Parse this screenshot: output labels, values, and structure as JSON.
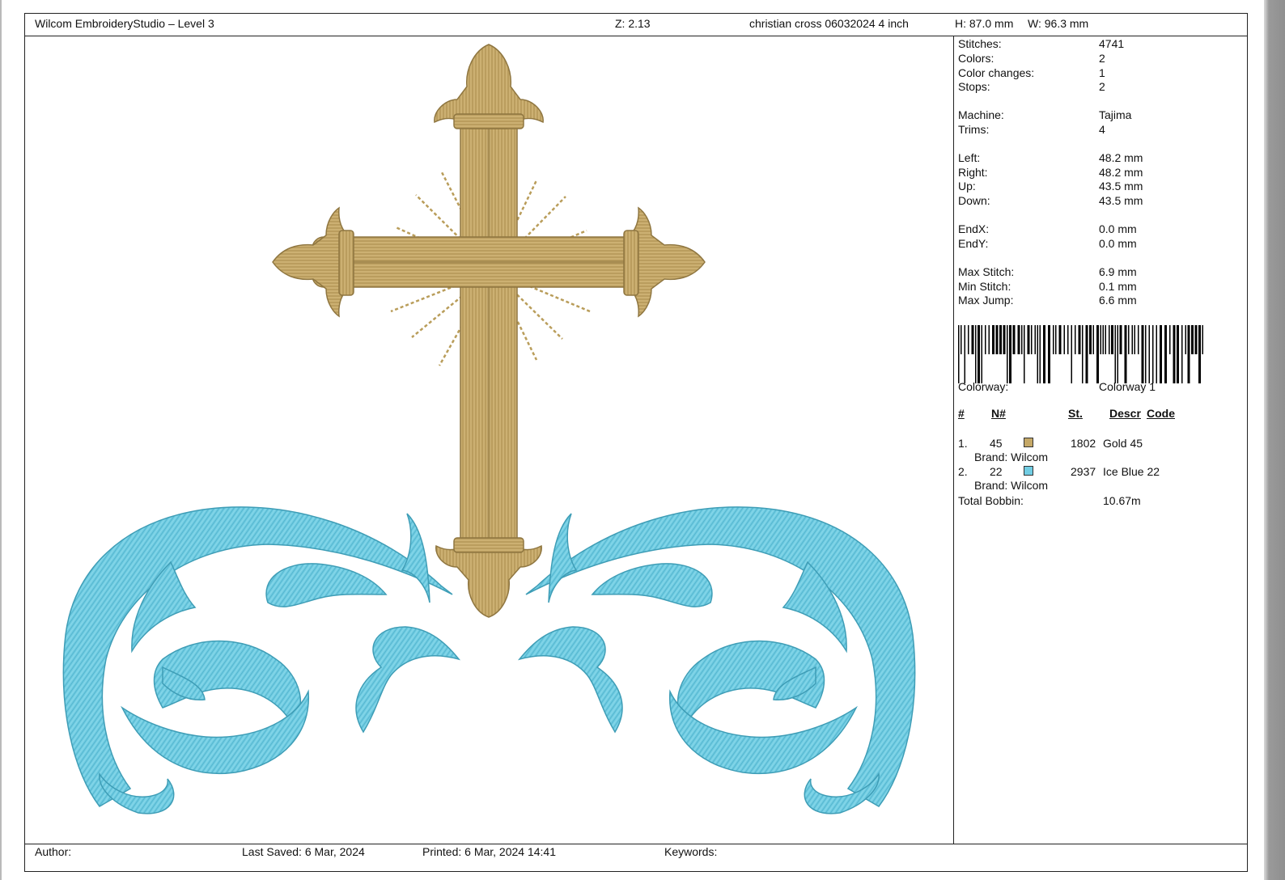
{
  "header": {
    "app_title": "Wilcom EmbroideryStudio – Level 3",
    "zoom": "Z: 2.13",
    "design_name": "christian cross 06032024 4 inch",
    "height": "H: 87.0 mm",
    "width": "W: 96.3 mm"
  },
  "stats": [
    {
      "label": "Stitches:",
      "value": "4741"
    },
    {
      "label": "Colors:",
      "value": "2"
    },
    {
      "label": "Color changes:",
      "value": "1"
    },
    {
      "label": "Stops:",
      "value": "2"
    },
    {
      "label": "Machine:",
      "value": "Tajima"
    },
    {
      "label": "Trims:",
      "value": "4"
    },
    {
      "label": "Left:",
      "value": "48.2 mm"
    },
    {
      "label": "Right:",
      "value": "48.2 mm"
    },
    {
      "label": "Up:",
      "value": "43.5 mm"
    },
    {
      "label": "Down:",
      "value": "43.5 mm"
    },
    {
      "label": "EndX:",
      "value": "0.0 mm"
    },
    {
      "label": "EndY:",
      "value": "0.0 mm"
    },
    {
      "label": "Max Stitch:",
      "value": "6.9 mm"
    },
    {
      "label": "Min Stitch:",
      "value": "0.1 mm"
    },
    {
      "label": "Max Jump:",
      "value": "6.6 mm"
    }
  ],
  "colorway": {
    "label": "Colorway:",
    "value": "Colorway 1"
  },
  "color_table": {
    "headers": {
      "num": "#",
      "n": "N#",
      "st": "St.",
      "descr": "Descr",
      "code": "Code"
    },
    "rows": [
      {
        "index": "1.",
        "n": "45",
        "stitches": "1802",
        "descr": "Gold 45",
        "brand": "Brand: Wilcom",
        "color": "#c5a867"
      },
      {
        "index": "2.",
        "n": "22",
        "stitches": "2937",
        "descr": "Ice Blue 22",
        "brand": "Brand: Wilcom",
        "color": "#71cde3"
      }
    ],
    "total_bobbin_label": "Total Bobbin:",
    "total_bobbin_value": "10.67m"
  },
  "footer": {
    "author": "Author:",
    "last_saved": "Last Saved:  6 Mar, 2024",
    "printed": "Printed:  6 Mar, 2024 14:41",
    "keywords": "Keywords:"
  },
  "colors": {
    "gold_thread": "#c5a867",
    "gold_shadow": "#8f7640",
    "ice_blue_thread": "#71cde3",
    "ice_blue_shadow": "#3e9db6"
  }
}
